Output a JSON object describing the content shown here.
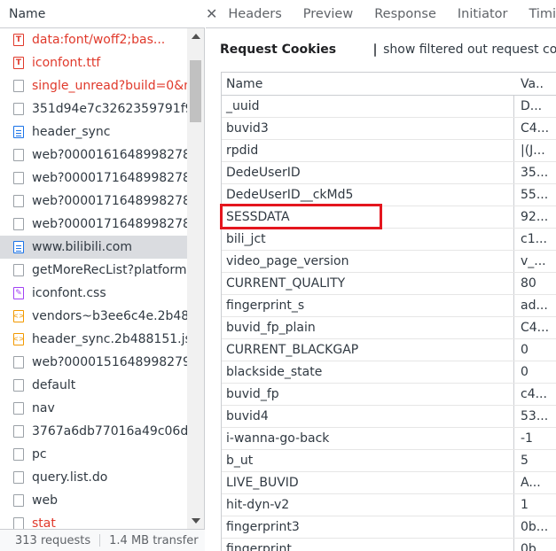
{
  "left": {
    "header": "Name",
    "requests": [
      {
        "name": "data:font/woff2;bas...",
        "icon": "font-file-icon",
        "type": "font",
        "error": true
      },
      {
        "name": "iconfont.ttf",
        "icon": "font-file-icon",
        "type": "font",
        "error": true
      },
      {
        "name": "single_unread?build=0&m",
        "icon": "file-icon",
        "type": "other",
        "error": true
      },
      {
        "name": "351d94e7c3262359791f9d",
        "icon": "file-icon",
        "type": "other",
        "error": false
      },
      {
        "name": "header_sync",
        "icon": "document-icon",
        "type": "doc",
        "error": false
      },
      {
        "name": "web?00001616489982788",
        "icon": "file-icon",
        "type": "other",
        "error": false
      },
      {
        "name": "web?00001716489982788",
        "icon": "file-icon",
        "type": "other",
        "error": false
      },
      {
        "name": "web?00001716489982788",
        "icon": "file-icon",
        "type": "other",
        "error": false
      },
      {
        "name": "web?00001716489982788",
        "icon": "file-icon",
        "type": "other",
        "error": false
      },
      {
        "name": "www.bilibili.com",
        "icon": "document-icon",
        "type": "doc",
        "error": false,
        "selected": true
      },
      {
        "name": "getMoreRecList?platform=",
        "icon": "file-icon",
        "type": "other",
        "error": false
      },
      {
        "name": "iconfont.css",
        "icon": "css-file-icon",
        "type": "css",
        "error": false
      },
      {
        "name": "vendors~b3ee6c4e.2b488.",
        "icon": "script-file-icon",
        "type": "js",
        "error": false
      },
      {
        "name": "header_sync.2b488151.js",
        "icon": "script-file-icon",
        "type": "js",
        "error": false
      },
      {
        "name": "web?00001516489982791",
        "icon": "file-icon",
        "type": "other",
        "error": false
      },
      {
        "name": "default",
        "icon": "file-icon",
        "type": "other",
        "error": false
      },
      {
        "name": "nav",
        "icon": "file-icon",
        "type": "other",
        "error": false
      },
      {
        "name": "3767a6db77016a49c06db.",
        "icon": "file-icon",
        "type": "other",
        "error": false
      },
      {
        "name": "pc",
        "icon": "file-icon",
        "type": "other",
        "error": false
      },
      {
        "name": "query.list.do",
        "icon": "file-icon",
        "type": "other",
        "error": false
      },
      {
        "name": "web",
        "icon": "file-icon",
        "type": "other",
        "error": false
      },
      {
        "name": "stat",
        "icon": "file-icon",
        "type": "other",
        "error": true
      }
    ],
    "status_requests": "313 requests",
    "status_transferred": "1.4 MB transfer"
  },
  "right": {
    "tabs": [
      "Headers",
      "Preview",
      "Response",
      "Initiator",
      "Timi"
    ],
    "section_title": "Request Cookies",
    "filter_label": "show filtered out request coo",
    "columns": {
      "name": "Name",
      "value": "Va.."
    },
    "cookies": [
      {
        "name": "_uuid",
        "value": "D..."
      },
      {
        "name": "buvid3",
        "value": "C4..."
      },
      {
        "name": "rpdid",
        "value": "|(J..."
      },
      {
        "name": "DedeUserID",
        "value": "35..."
      },
      {
        "name": "DedeUserID__ckMd5",
        "value": "55..."
      },
      {
        "name": "SESSDATA",
        "value": "92...",
        "highlighted": true
      },
      {
        "name": "bili_jct",
        "value": "c1..."
      },
      {
        "name": "video_page_version",
        "value": "v_..."
      },
      {
        "name": "CURRENT_QUALITY",
        "value": "80"
      },
      {
        "name": "fingerprint_s",
        "value": "ad..."
      },
      {
        "name": "buvid_fp_plain",
        "value": "C4..."
      },
      {
        "name": "CURRENT_BLACKGAP",
        "value": "0"
      },
      {
        "name": "blackside_state",
        "value": "0"
      },
      {
        "name": "buvid_fp",
        "value": "c4..."
      },
      {
        "name": "buvid4",
        "value": "53..."
      },
      {
        "name": "i-wanna-go-back",
        "value": "-1"
      },
      {
        "name": "b_ut",
        "value": "5"
      },
      {
        "name": "LIVE_BUVID",
        "value": "A..."
      },
      {
        "name": "hit-dyn-v2",
        "value": "1"
      },
      {
        "name": "fingerprint3",
        "value": "0b..."
      },
      {
        "name": "fingerprint",
        "value": "0b..."
      }
    ]
  },
  "colors": {
    "error_text": "#e0392b",
    "highlight_border": "#e4161e",
    "selected_row": "#dadce0"
  }
}
